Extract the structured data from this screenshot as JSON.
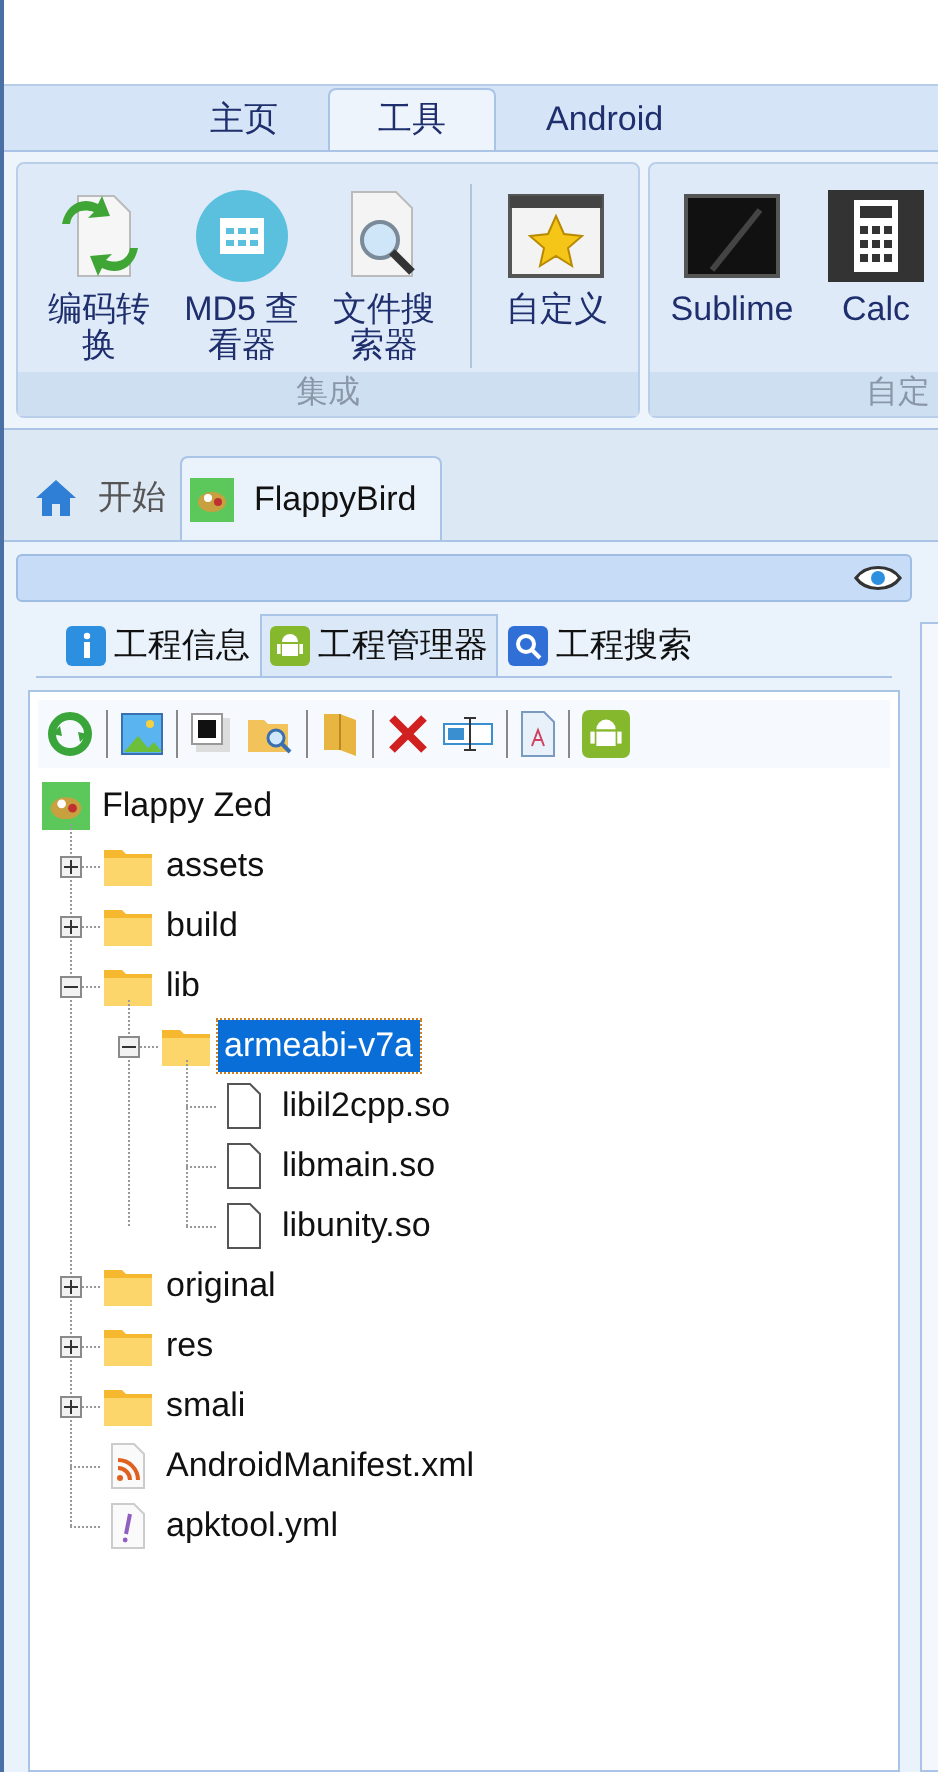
{
  "ribbon": {
    "tabs": [
      {
        "label": "主页",
        "selected": false
      },
      {
        "label": "工具",
        "selected": true
      },
      {
        "label": "Android",
        "selected": false
      }
    ],
    "groups": [
      {
        "label": "集成",
        "buttons": [
          {
            "label": "编码转换"
          },
          {
            "label": "MD5 查看器"
          },
          {
            "label": "文件搜索器"
          },
          {
            "label": "自定义"
          }
        ]
      },
      {
        "label": "自定",
        "buttons": [
          {
            "label": "Sublime"
          },
          {
            "label": "Calc"
          }
        ]
      }
    ]
  },
  "document_tabs": [
    {
      "label": "开始",
      "selected": false
    },
    {
      "label": "FlappyBird",
      "selected": true
    }
  ],
  "project_tabs": [
    {
      "label": "工程信息",
      "selected": false
    },
    {
      "label": "工程管理器",
      "selected": true
    },
    {
      "label": "工程搜索",
      "selected": false
    }
  ],
  "tree": {
    "label": "Flappy Zed",
    "children": [
      {
        "kind": "folder",
        "label": "assets",
        "expanded": false,
        "selected": false
      },
      {
        "kind": "folder",
        "label": "build",
        "expanded": false,
        "selected": false
      },
      {
        "kind": "folder",
        "label": "lib",
        "expanded": true,
        "selected": false,
        "children": [
          {
            "kind": "folder",
            "label": "armeabi-v7a",
            "expanded": true,
            "selected": true,
            "children": [
              {
                "kind": "file",
                "label": "libil2cpp.so",
                "selected": false
              },
              {
                "kind": "file",
                "label": "libmain.so",
                "selected": false
              },
              {
                "kind": "file",
                "label": "libunity.so",
                "selected": false
              }
            ]
          }
        ]
      },
      {
        "kind": "folder",
        "label": "original",
        "expanded": false,
        "selected": false
      },
      {
        "kind": "folder",
        "label": "res",
        "expanded": false,
        "selected": false
      },
      {
        "kind": "folder",
        "label": "smali",
        "expanded": false,
        "selected": false
      },
      {
        "kind": "xml",
        "label": "AndroidManifest.xml",
        "selected": false
      },
      {
        "kind": "yml",
        "label": "apktool.yml",
        "selected": false
      }
    ]
  }
}
